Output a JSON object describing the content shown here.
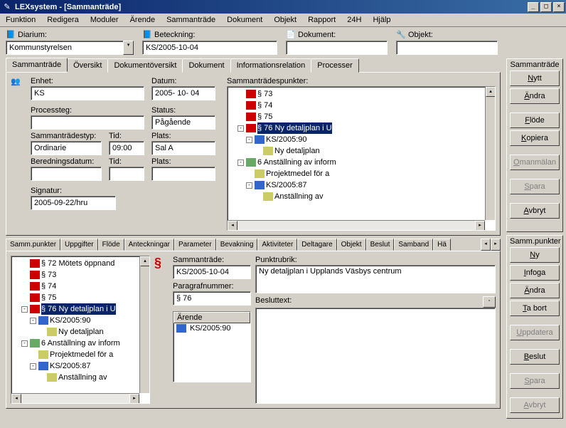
{
  "window": {
    "title": "LEXsystem - [Sammanträde]"
  },
  "menu": [
    "Funktion",
    "Redigera",
    "Moduler",
    "Ärende",
    "Sammanträde",
    "Dokument",
    "Objekt",
    "Rapport",
    "24H",
    "Hjälp"
  ],
  "topfields": {
    "diarium": {
      "label": "Diarium:",
      "value": "Kommunstyrelsen"
    },
    "beteckning": {
      "label": "Beteckning:",
      "value": "KS/2005-10-04"
    },
    "dokument": {
      "label": "Dokument:",
      "value": ""
    },
    "objekt": {
      "label": "Objekt:",
      "value": ""
    }
  },
  "mainTabs": [
    "Sammanträde",
    "Översikt",
    "Dokumentöversikt",
    "Dokument",
    "Informationsrelation",
    "Processer"
  ],
  "meeting": {
    "enhet": {
      "label": "Enhet:",
      "value": "KS"
    },
    "datum": {
      "label": "Datum:",
      "value": "2005- 10- 04"
    },
    "processteg": {
      "label": "Processteg:",
      "value": ""
    },
    "status": {
      "label": "Status:",
      "value": "Pågående"
    },
    "typ": {
      "label": "Sammanträdestyp:",
      "value": "Ordinarie"
    },
    "tid": {
      "label": "Tid:",
      "value": "09:00"
    },
    "plats": {
      "label": "Plats:",
      "value": "Sal A"
    },
    "bered": {
      "label": "Beredningsdatum:",
      "value": ""
    },
    "tid2": {
      "label": "Tid:",
      "value": ""
    },
    "plats2": {
      "label": "Plats:",
      "value": ""
    },
    "signatur": {
      "label": "Signatur:",
      "value": "2005-09-22/hru"
    },
    "punkterLabel": "Sammanträdespunkter:"
  },
  "tree1": [
    {
      "ind": 2,
      "ico": "para",
      "label": "§ 73"
    },
    {
      "ind": 2,
      "ico": "para",
      "label": "§ 74"
    },
    {
      "ind": 2,
      "ico": "para",
      "label": "§ 75"
    },
    {
      "ind": 1,
      "exp": "-",
      "ico": "para",
      "label": "§ 76 Ny detaljplan i U",
      "sel": true
    },
    {
      "ind": 2,
      "exp": "-",
      "ico": "doc",
      "label": "KS/2005:90"
    },
    {
      "ind": 4,
      "ico": "file",
      "label": "Ny detaljplan"
    },
    {
      "ind": 1,
      "exp": "-",
      "ico": "hash",
      "label": "6 Anställning av inform"
    },
    {
      "ind": 3,
      "ico": "file",
      "label": "Projektmedel för a"
    },
    {
      "ind": 2,
      "exp": "-",
      "ico": "doc",
      "label": "KS/2005:87"
    },
    {
      "ind": 4,
      "ico": "file",
      "label": "Anställning av"
    }
  ],
  "side1": {
    "title": "Sammanträde",
    "buttons": [
      {
        "label": "Nytt",
        "u": true
      },
      {
        "label": "Ändra",
        "u": true
      },
      {
        "label": "Flöde",
        "u": true
      },
      {
        "label": "Kopiera",
        "u": true
      },
      {
        "label": "Omanmälan",
        "u": true,
        "dis": true
      },
      {
        "label": "Spara",
        "u": true,
        "dis": true
      },
      {
        "label": "Avbryt",
        "u": true
      }
    ]
  },
  "subTabs": [
    "Samm.punkter",
    "Uppgifter",
    "Flöde",
    "Anteckningar",
    "Parameter",
    "Bevakning",
    "Aktiviteter",
    "Deltagare",
    "Objekt",
    "Beslut",
    "Samband",
    "Hä"
  ],
  "tree2": [
    {
      "ind": 2,
      "ico": "para",
      "label": "§ 72 Mötets öppnand"
    },
    {
      "ind": 2,
      "ico": "para",
      "label": "§ 73"
    },
    {
      "ind": 2,
      "ico": "para",
      "label": "§ 74"
    },
    {
      "ind": 2,
      "ico": "para",
      "label": "§ 75"
    },
    {
      "ind": 1,
      "exp": "-",
      "ico": "para",
      "label": "§ 76 Ny detaljplan i U",
      "sel": true
    },
    {
      "ind": 2,
      "exp": "-",
      "ico": "doc",
      "label": "KS/2005:90"
    },
    {
      "ind": 4,
      "ico": "file",
      "label": "Ny detaljplan"
    },
    {
      "ind": 1,
      "exp": "-",
      "ico": "hash",
      "label": "6 Anställning av inform"
    },
    {
      "ind": 3,
      "ico": "file",
      "label": "Projektmedel för a"
    },
    {
      "ind": 2,
      "exp": "-",
      "ico": "doc",
      "label": "KS/2005:87"
    },
    {
      "ind": 4,
      "ico": "file",
      "label": "Anställning av"
    }
  ],
  "detail": {
    "sammantrade": {
      "label": "Sammanträde:",
      "value": "KS/2005-10-04"
    },
    "punktrubrik": {
      "label": "Punktrubrik:",
      "value": "Ny detaljplan i Upplands Väsbys centrum"
    },
    "paragrafnr": {
      "label": "Paragrafnummer:",
      "value": "§ 76"
    },
    "besluttext": {
      "label": "Besluttext:",
      "value": ""
    },
    "arendeHdr": "Ärende",
    "arendeItem": "KS/2005:90"
  },
  "side2": {
    "title": "Samm.punkter",
    "buttons": [
      {
        "label": "Ny",
        "u": true
      },
      {
        "label": "Infoga",
        "u": true
      },
      {
        "label": "Ändra",
        "u": true
      },
      {
        "label": "Ta bort",
        "u": true
      },
      {
        "label": "Uppdatera",
        "u": true,
        "dis": true
      },
      {
        "label": "Beslut",
        "u": true
      },
      {
        "label": "Spara",
        "u": true,
        "dis": true
      },
      {
        "label": "Avbryt",
        "u": true,
        "dis": true
      }
    ]
  }
}
